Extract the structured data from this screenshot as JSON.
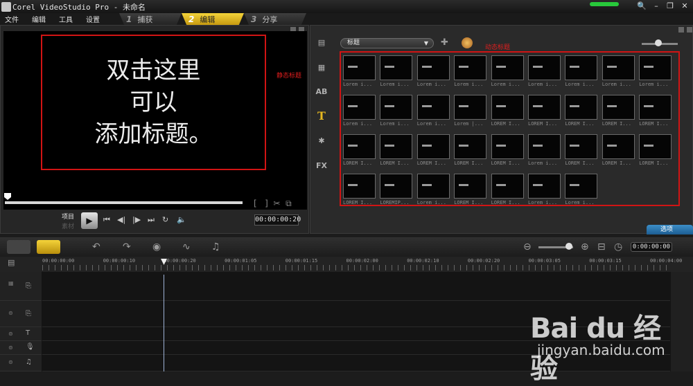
{
  "window": {
    "title": "Corel VideoStudio Pro - 未命名",
    "controls": [
      "🔍",
      "–",
      "❐",
      "✕"
    ]
  },
  "menu": [
    "文件",
    "编辑",
    "工具",
    "设置"
  ],
  "steps": [
    {
      "num": "1",
      "label": "捕获",
      "active": false
    },
    {
      "num": "2",
      "label": "编辑",
      "active": true
    },
    {
      "num": "3",
      "label": "分享",
      "active": false
    }
  ],
  "preview": {
    "title_lines": [
      "双击这里",
      "可以",
      "添加标题。"
    ],
    "annotation_static": "静态标题",
    "project_label": "项目",
    "clip_label": "素材",
    "timecode": "00:00:00:20"
  },
  "library": {
    "category": "标题",
    "annotation_dynamic": "动态标题",
    "captions": [
      "Lorem i...",
      "Lorem i...",
      "Lorem i...",
      "Lorem i...",
      "Lorem i...",
      "Lorem i...",
      "Lorem i...",
      "Lorem i...",
      "Lorem i...",
      "Lorem i...",
      "Lorem i...",
      "Lorem i...",
      "Lorem |...",
      "LOREM I...",
      "LOREM I...",
      "LOREM I...",
      "LOREM I...",
      "LOREM I...",
      "LOREM I...",
      "LOREM I...",
      "LOREM I...",
      "LOREM I...",
      "LOREM I...",
      "Lorem i...",
      "LOREM I...",
      "LOREM I...",
      "LOREM I...",
      "LOREM I...",
      "LOREMIP...",
      "Lorem i...",
      "LOREM I...",
      "LOREM I...",
      "Lorem i...",
      "Lorem i..."
    ],
    "options_tab": "选项"
  },
  "timeline": {
    "total_time": "0:00:00:00",
    "ruler": [
      "00:00:00:00",
      "00:00:00:10",
      "00:00:00:20",
      "00:00:01:05",
      "00:00:01:15",
      "00:00:02:00",
      "00:00:02:10",
      "00:00:02:20",
      "00:00:03:05",
      "00:00:03:15",
      "00:00:04:00"
    ]
  },
  "watermark": {
    "brand": "Bai du 经验",
    "url": "jingyan.baidu.com"
  }
}
